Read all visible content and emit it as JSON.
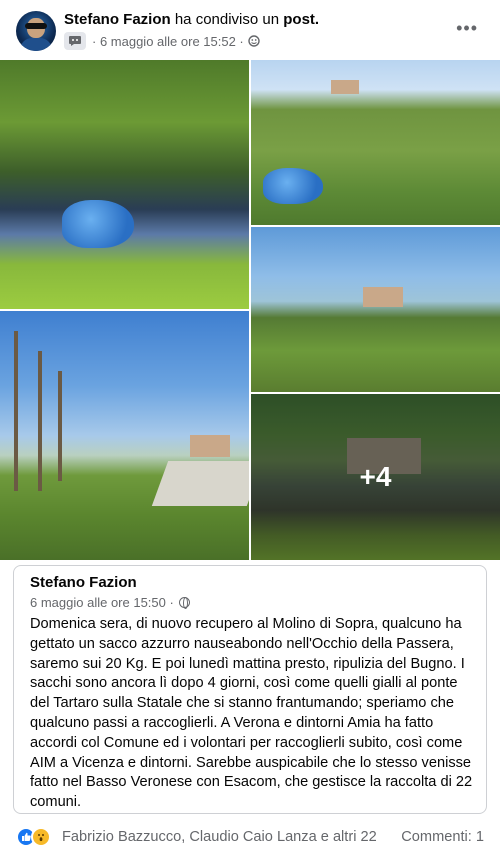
{
  "post": {
    "author": "Stefano Fazion",
    "action": "ha condiviso un",
    "object": "post.",
    "timestamp": "· 6 maggio alle ore 15:52 ·",
    "audience_icon": "friends-icon",
    "more_label": "•••"
  },
  "photos": {
    "more_count": "+4"
  },
  "shared": {
    "author": "Stefano Fazion",
    "timestamp": "6 maggio alle ore 15:50 ·",
    "audience_icon": "globe-icon",
    "text": "Domenica sera, di nuovo recupero al Molino di Sopra, qualcuno ha gettato un sacco azzurro nauseabondo nell'Occhio della Passera, saremo sui 20 Kg. E poi lunedì mattina presto, ripulizia del Bugno. I sacchi sono ancora lì dopo 4 giorni, così come quelli gialli al ponte del Tartaro sulla Statale che si stanno frantumando; speriamo che qualcuno passi a raccoglierli. A Verona e dintorni Amia ha fatto accordi col Comune ed i volontari per raccoglierli subito, così come AIM a Vicenza e dintorni. Sarebbe auspicabile che lo stesso venisse fatto nel Basso Veronese con Esacom, che gestisce la raccolta di 22 comuni."
  },
  "footer": {
    "reactions": [
      "like-icon",
      "wow-icon"
    ],
    "reactors": "Fabrizio Bazzucco, Claudio Caio Lanza e altri 22",
    "comments": "Commenti: 1"
  },
  "colors": {
    "secondary_text": "#65676b",
    "like_blue": "#1877f2",
    "border": "#ced0d4"
  }
}
